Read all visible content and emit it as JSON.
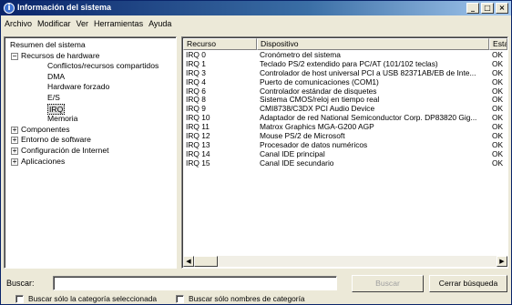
{
  "window": {
    "title": "Información del sistema",
    "icon": "info-icon",
    "controls": [
      "_",
      "□",
      "×"
    ]
  },
  "menu": [
    "Archivo",
    "Modificar",
    "Ver",
    "Herramientas",
    "Ayuda"
  ],
  "tree": {
    "items": [
      {
        "label": "Resumen del sistema",
        "level": 0,
        "expander": ""
      },
      {
        "label": "Recursos de hardware",
        "level": 1,
        "expander": "−"
      },
      {
        "label": "Conflictos/recursos compartidos",
        "level": 2,
        "expander": ""
      },
      {
        "label": "DMA",
        "level": 2,
        "expander": ""
      },
      {
        "label": "Hardware forzado",
        "level": 2,
        "expander": ""
      },
      {
        "label": "E/S",
        "level": 2,
        "expander": ""
      },
      {
        "label": "IRQ",
        "level": 2,
        "expander": "",
        "selected": true
      },
      {
        "label": "Memoria",
        "level": 2,
        "expander": ""
      },
      {
        "label": "Componentes",
        "level": 1,
        "expander": "+"
      },
      {
        "label": "Entorno de software",
        "level": 1,
        "expander": "+"
      },
      {
        "label": "Configuración de Internet",
        "level": 1,
        "expander": "+"
      },
      {
        "label": "Aplicaciones",
        "level": 1,
        "expander": "+"
      }
    ]
  },
  "table": {
    "columns": [
      "Recurso",
      "Dispositivo",
      "Estad"
    ],
    "rows": [
      [
        "IRQ 0",
        "Cronómetro del sistema",
        "OK"
      ],
      [
        "IRQ 1",
        "Teclado PS/2 extendido para PC/AT (101/102 teclas)",
        "OK"
      ],
      [
        "IRQ 3",
        "Controlador de host universal PCI a USB 82371AB/EB de Inte...",
        "OK"
      ],
      [
        "IRQ 4",
        "Puerto de comunicaciones (COM1)",
        "OK"
      ],
      [
        "IRQ 6",
        "Controlador estándar de disquetes",
        "OK"
      ],
      [
        "IRQ 8",
        "Sistema CMOS/reloj en tiempo real",
        "OK"
      ],
      [
        "IRQ 9",
        "CMI8738/C3DX PCI Audio Device",
        "OK"
      ],
      [
        "IRQ 10",
        "Adaptador de red National Semiconductor Corp. DP83820 Gig...",
        "OK"
      ],
      [
        "IRQ 11",
        "Matrox Graphics MGA-G200 AGP",
        "OK"
      ],
      [
        "IRQ 12",
        "Mouse PS/2 de Microsoft",
        "OK"
      ],
      [
        "IRQ 13",
        "Procesador de datos numéricos",
        "OK"
      ],
      [
        "IRQ 14",
        "Canal IDE principal",
        "OK"
      ],
      [
        "IRQ 15",
        "Canal IDE secundario",
        "OK"
      ]
    ]
  },
  "scroll": {
    "left_arrow": "◀",
    "right_arrow": "▶"
  },
  "search": {
    "label": "Buscar:",
    "value": "",
    "find_button": "Buscar",
    "close_button": "Cerrar búsqueda"
  },
  "checkboxes": [
    {
      "label": "Buscar sólo la categoría seleccionada",
      "checked": false
    },
    {
      "label": "Buscar sólo nombres de categoría",
      "checked": false
    }
  ]
}
